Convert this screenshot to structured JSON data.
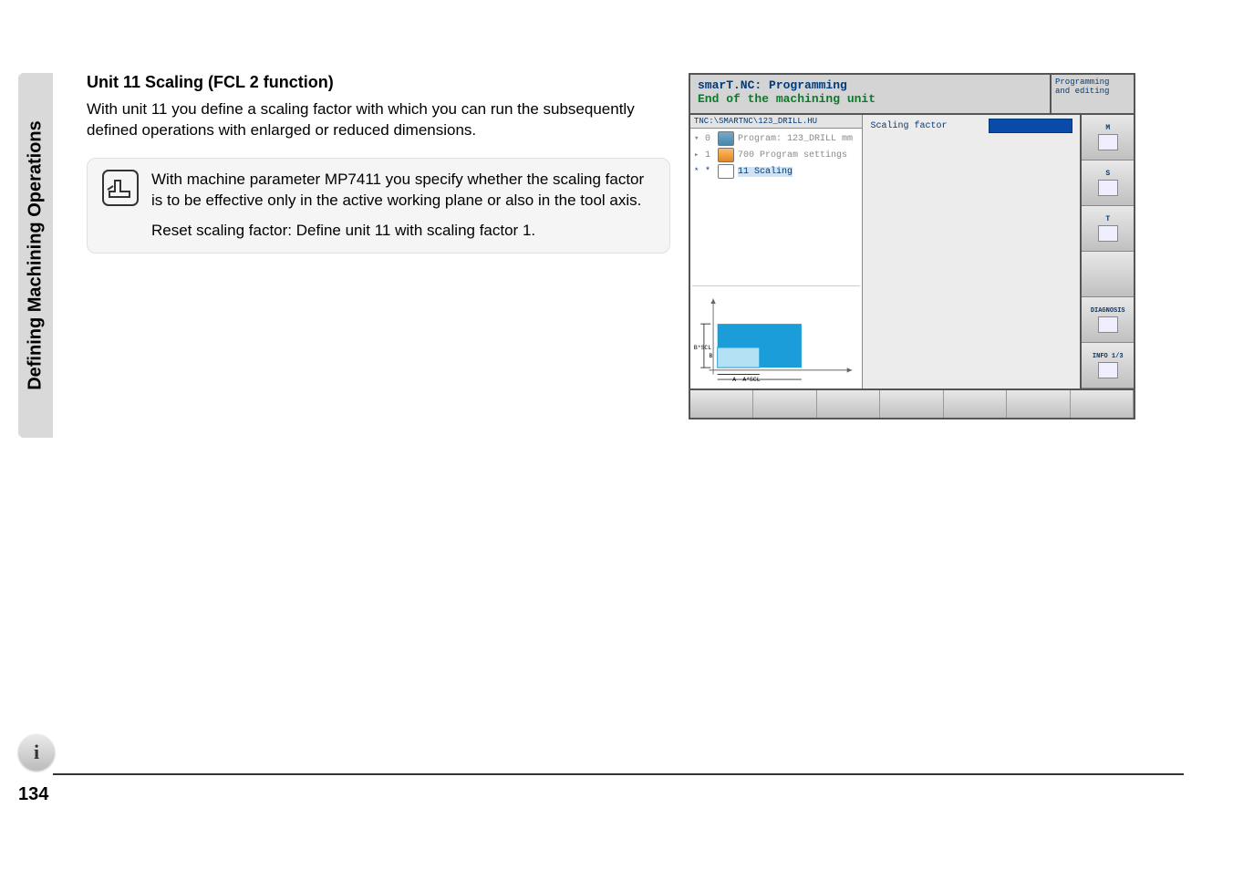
{
  "sidebar": {
    "title": "Defining Machining Operations"
  },
  "main": {
    "heading": "Unit 11 Scaling (FCL 2 function)",
    "paragraph": "With unit 11 you define a scaling factor with which you can run the subsequently defined operations with enlarged or reduced dimensions.",
    "note": {
      "p1": "With machine parameter MP7411 you specify whether the scaling factor is to be effective only in the active working plane or also in the tool axis.",
      "p2": "Reset scaling factor: Define unit 11 with scaling factor 1."
    }
  },
  "screen": {
    "title_line1": "smarT.NC: Programming",
    "title_line2": "End of the machining unit",
    "mode_line1": "Programming",
    "mode_line2": "and editing",
    "path": "TNC:\\SMARTNC\\123_DRILL.HU",
    "tree": [
      {
        "idx": "0",
        "label": "Program: 123_DRILL mm",
        "icon": "prog"
      },
      {
        "idx": "1",
        "label": "700 Program settings",
        "icon": "set"
      },
      {
        "idx": "*",
        "label": "11 Scaling",
        "icon": "scale",
        "selected": true
      }
    ],
    "param": {
      "label": "Scaling factor",
      "value": ""
    },
    "graphic_labels": {
      "bscl": "B*SCL",
      "b": "B",
      "a": "A",
      "ascl": "A*SCL"
    },
    "softkeys": [
      {
        "label": "M"
      },
      {
        "label": "S"
      },
      {
        "label": "T"
      },
      {
        "label": ""
      },
      {
        "label": "DIAGNOSIS",
        "klass": "diag"
      },
      {
        "label": "INFO 1/3",
        "klass": "info"
      }
    ]
  },
  "page": {
    "number": "134",
    "info_icon": "i"
  }
}
